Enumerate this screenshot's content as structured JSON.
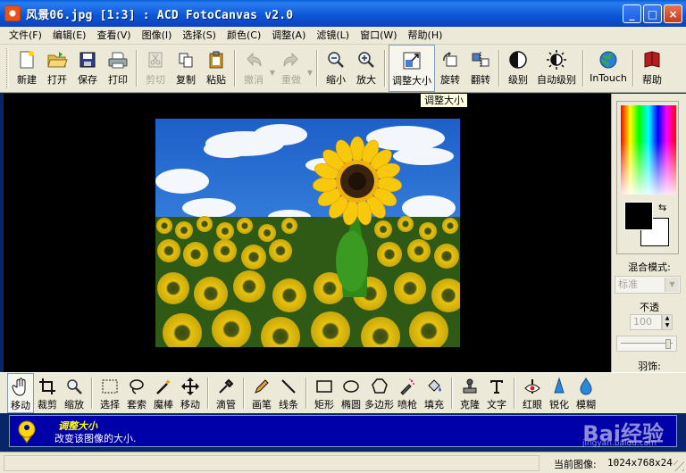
{
  "window": {
    "title": "风景06.jpg [1:3] : ACD FotoCanvas v2.0",
    "minimize": "_",
    "maximize": "□",
    "close": "×"
  },
  "menu": [
    "文件(F)",
    "编辑(E)",
    "查看(V)",
    "图像(I)",
    "选择(S)",
    "颜色(C)",
    "调整(A)",
    "滤镜(L)",
    "窗口(W)",
    "帮助(H)"
  ],
  "toolbar": {
    "new": "新建",
    "open": "打开",
    "save": "保存",
    "print": "打印",
    "cut": "剪切",
    "copy": "复制",
    "paste": "粘贴",
    "undo": "撤消",
    "redo": "重做",
    "zoom_out": "缩小",
    "zoom_in": "放大",
    "resize": "调整大小",
    "rotate": "旋转",
    "flip": "翻转",
    "levels": "级别",
    "auto_levels": "自动级别",
    "intouch": "InTouch",
    "help": "帮助"
  },
  "tooltip": "调整大小",
  "panel": {
    "blend_mode_label": "混合模式:",
    "blend_mode_value": "标准",
    "opacity_label": "不透",
    "opacity_value": "100",
    "feather_label": "羽饰:",
    "swap_glyph": "⇆"
  },
  "tools": {
    "move_hand": "移动",
    "crop": "裁剪",
    "zoom": "缩放",
    "select": "选择",
    "lasso": "套索",
    "magic_wand": "魔棒",
    "move": "移动",
    "eyedropper": "滴管",
    "pencil": "画笔",
    "line": "线条",
    "rectangle": "矩形",
    "ellipse": "椭圆",
    "polygon": "多边形",
    "airbrush": "喷枪",
    "fill": "填充",
    "clone": "克隆",
    "text": "文字",
    "red_eye": "红眼",
    "sharpen": "锐化",
    "blur": "模糊"
  },
  "hint": {
    "title": "调整大小",
    "text": "改变该图像的大小.",
    "watermark": "Bai经验",
    "watermark_sub": "jingyan.baidu.com"
  },
  "status": {
    "label": "当前图像:",
    "value": "1024x768x24"
  },
  "colors": {
    "accent": "#0a246a",
    "hint_bg": "#0000a8",
    "face": "#ece9d8"
  }
}
